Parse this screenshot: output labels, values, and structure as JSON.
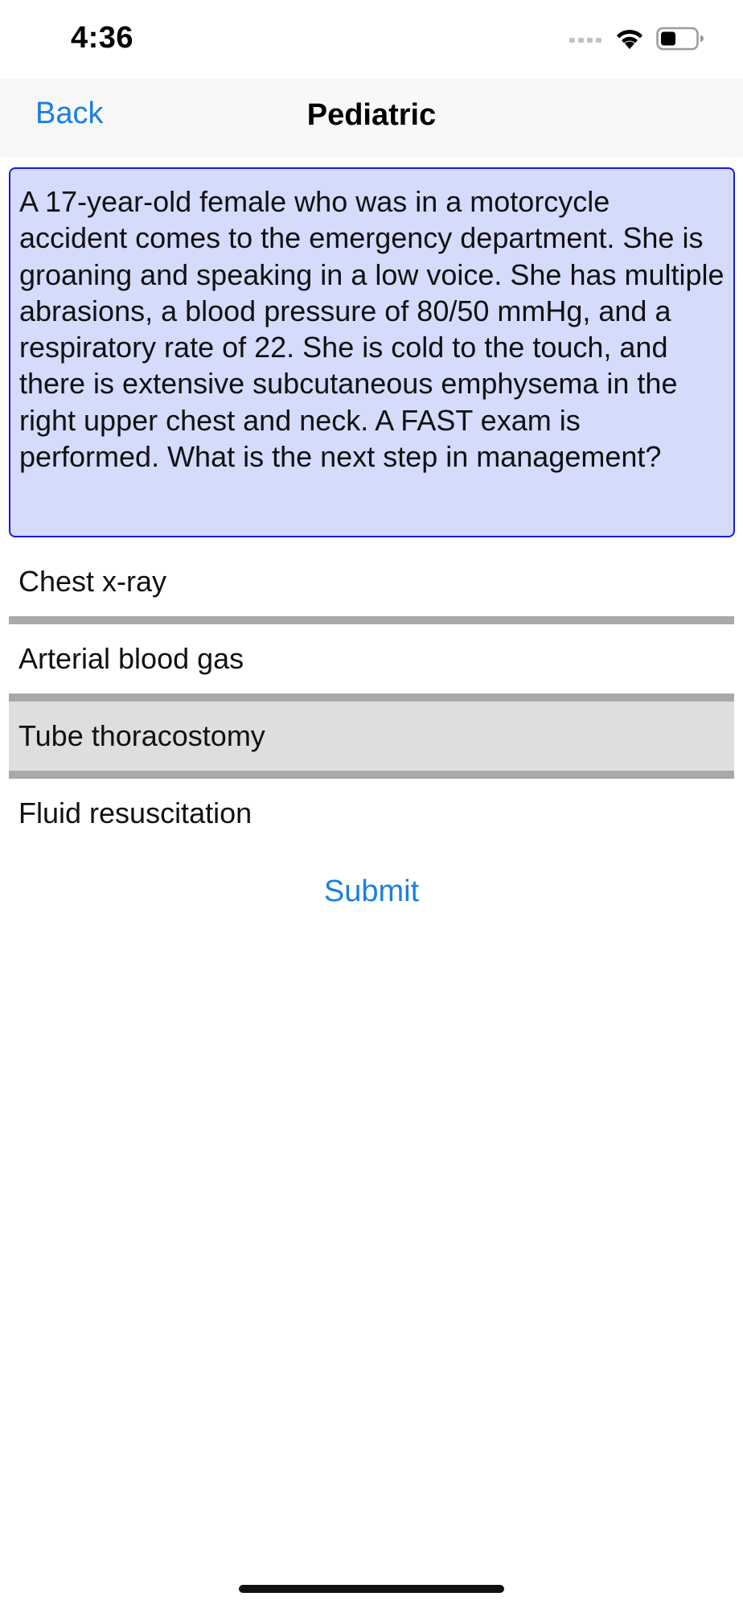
{
  "status_bar": {
    "time": "4:36"
  },
  "nav": {
    "back_label": "Back",
    "title": "Pediatric"
  },
  "question": {
    "text": "A 17-year-old female who was in a motorcycle accident comes to the emergency department. She is groaning and speaking in a low voice. She has multiple abrasions, a blood pressure of 80/50 mmHg, and a respiratory rate of 22. She is cold to the touch, and there is extensive subcutaneous emphysema in the right upper chest and neck. A FAST exam is performed. What is the next step in management?"
  },
  "answers": [
    {
      "label": "Chest x-ray",
      "selected": false
    },
    {
      "label": "Arterial blood gas",
      "selected": false
    },
    {
      "label": "Tube thoracostomy",
      "selected": true
    },
    {
      "label": "Fluid resuscitation",
      "selected": false
    }
  ],
  "submit_label": "Submit",
  "colors": {
    "accent": "#1a7fe3",
    "question_background": "#d4dbfb",
    "question_border": "#1a1adc",
    "selected_background": "#dedede",
    "divider": "#a9a9a9"
  },
  "icons": {
    "signal": "cellular-signal-icon",
    "wifi": "wifi-icon",
    "battery": "battery-icon"
  }
}
